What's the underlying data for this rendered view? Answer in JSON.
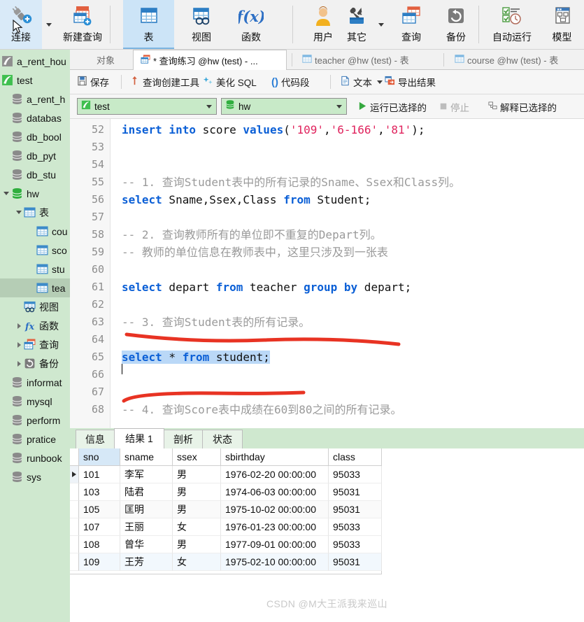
{
  "toolbar": {
    "items": [
      {
        "label": "连接",
        "icon": "connect-plug-icon",
        "caret": true,
        "selected": false
      },
      {
        "label": "新建查询",
        "icon": "new-query-icon",
        "caret": false,
        "selected": false
      },
      {
        "label": "表",
        "icon": "table-icon",
        "caret": false,
        "selected": true
      },
      {
        "label": "视图",
        "icon": "view-icon",
        "caret": false,
        "selected": false
      },
      {
        "label": "函数",
        "icon": "function-fx-icon",
        "caret": false,
        "selected": false
      },
      {
        "label": "用户",
        "icon": "user-icon",
        "caret": false,
        "selected": false
      },
      {
        "label": "其它",
        "icon": "other-tools-icon",
        "caret": true,
        "selected": false
      },
      {
        "label": "查询",
        "icon": "query-icon",
        "caret": false,
        "selected": false
      },
      {
        "label": "备份",
        "icon": "backup-icon",
        "caret": false,
        "selected": false
      },
      {
        "label": "自动运行",
        "icon": "automation-icon",
        "caret": false,
        "selected": false
      },
      {
        "label": "模型",
        "icon": "model-icon",
        "caret": false,
        "selected": false
      }
    ]
  },
  "tabs": [
    {
      "label": "对象",
      "icon": "",
      "active": false
    },
    {
      "label": "* 查询练习 @hw (test) - ...",
      "icon": "query-tab-icon",
      "active": true
    },
    {
      "label": "teacher @hw (test) - 表",
      "icon": "table-tab-icon",
      "active": false
    },
    {
      "label": "course @hw (test) - 表",
      "icon": "table-tab-icon",
      "active": false
    }
  ],
  "actionbar": {
    "items": [
      {
        "label": "保存",
        "icon": "save-icon"
      },
      {
        "label": "查询创建工具",
        "icon": "query-builder-icon"
      },
      {
        "label": "美化 SQL",
        "icon": "beautify-sql-icon"
      },
      {
        "label": "代码段",
        "icon": "code-snippet-icon"
      },
      {
        "label": "文本",
        "icon": "text-icon",
        "caret": true
      },
      {
        "label": "导出结果",
        "icon": "export-result-icon"
      }
    ]
  },
  "connbar": {
    "connection": {
      "value": "test",
      "icon": "connection-icon"
    },
    "database": {
      "value": "hw",
      "icon": "database-icon"
    },
    "run_selected": "运行已选择的",
    "stop": "停止",
    "explain_selected": "解释已选择的"
  },
  "sidebar": {
    "items": [
      {
        "label": "a_rent_hou",
        "indent": 0,
        "icon": "connection-icon",
        "twisty": "",
        "selected": false
      },
      {
        "label": "test",
        "indent": 0,
        "icon": "connection-icon-green",
        "twisty": "",
        "selected": false
      },
      {
        "label": "a_rent_h",
        "indent": 1,
        "icon": "database-icon",
        "twisty": "",
        "selected": false
      },
      {
        "label": "databas",
        "indent": 1,
        "icon": "database-icon",
        "twisty": "",
        "selected": false
      },
      {
        "label": "db_bool",
        "indent": 1,
        "icon": "database-icon",
        "twisty": "",
        "selected": false
      },
      {
        "label": "db_pyt",
        "indent": 1,
        "icon": "database-icon",
        "twisty": "",
        "selected": false
      },
      {
        "label": "db_stu",
        "indent": 1,
        "icon": "database-icon",
        "twisty": "",
        "selected": false
      },
      {
        "label": "hw",
        "indent": 1,
        "icon": "database-icon-green",
        "twisty": "down",
        "selected": false
      },
      {
        "label": "表",
        "indent": 2,
        "icon": "table-folder-icon",
        "twisty": "down",
        "selected": false
      },
      {
        "label": "cou",
        "indent": 3,
        "icon": "table-icon",
        "twisty": "",
        "selected": false
      },
      {
        "label": "sco",
        "indent": 3,
        "icon": "table-icon",
        "twisty": "",
        "selected": false
      },
      {
        "label": "stu",
        "indent": 3,
        "icon": "table-icon",
        "twisty": "",
        "selected": false
      },
      {
        "label": "tea",
        "indent": 3,
        "icon": "table-icon",
        "twisty": "",
        "selected": true
      },
      {
        "label": "视图",
        "indent": 2,
        "icon": "view-icon",
        "twisty": "",
        "selected": false
      },
      {
        "label": "函数",
        "indent": 2,
        "icon": "function-fx-icon",
        "twisty": "right",
        "selected": false
      },
      {
        "label": "查询",
        "indent": 2,
        "icon": "query-icon",
        "twisty": "right",
        "selected": false
      },
      {
        "label": "备份",
        "indent": 2,
        "icon": "backup-icon",
        "twisty": "right",
        "selected": false
      },
      {
        "label": "informat",
        "indent": 1,
        "icon": "database-icon",
        "twisty": "",
        "selected": false
      },
      {
        "label": "mysql",
        "indent": 1,
        "icon": "database-icon",
        "twisty": "",
        "selected": false
      },
      {
        "label": "perform",
        "indent": 1,
        "icon": "database-icon",
        "twisty": "",
        "selected": false
      },
      {
        "label": "pratice",
        "indent": 1,
        "icon": "database-icon",
        "twisty": "",
        "selected": false
      },
      {
        "label": "runbook",
        "indent": 1,
        "icon": "database-icon",
        "twisty": "",
        "selected": false
      },
      {
        "label": "sys",
        "indent": 1,
        "icon": "database-icon",
        "twisty": "",
        "selected": false
      }
    ]
  },
  "editor": {
    "lines": [
      {
        "n": "52",
        "segments": [
          {
            "t": "insert into",
            "c": "kw"
          },
          {
            "t": " score ",
            "c": ""
          },
          {
            "t": "values",
            "c": "kw"
          },
          {
            "t": "(",
            "c": ""
          },
          {
            "t": "'109'",
            "c": "str"
          },
          {
            "t": ",",
            "c": ""
          },
          {
            "t": "'6-166'",
            "c": "str"
          },
          {
            "t": ",",
            "c": ""
          },
          {
            "t": "'81'",
            "c": "str"
          },
          {
            "t": ");",
            "c": ""
          }
        ]
      },
      {
        "n": "53",
        "segments": []
      },
      {
        "n": "54",
        "segments": []
      },
      {
        "n": "55",
        "segments": [
          {
            "t": "-- 1. 查询Student表中的所有记录的Sname、Ssex和Class列。",
            "c": "cmt"
          }
        ]
      },
      {
        "n": "56",
        "segments": [
          {
            "t": "select",
            "c": "kw"
          },
          {
            "t": " Sname,Ssex,Class ",
            "c": ""
          },
          {
            "t": "from",
            "c": "kw"
          },
          {
            "t": " Student;",
            "c": ""
          }
        ]
      },
      {
        "n": "57",
        "segments": []
      },
      {
        "n": "58",
        "segments": [
          {
            "t": "-- 2. 查询教师所有的单位即不重复的Depart列。",
            "c": "cmt"
          }
        ]
      },
      {
        "n": "59",
        "segments": [
          {
            "t": "-- 教师的单位信息在教师表中，这里只涉及到一张表",
            "c": "cmt"
          }
        ]
      },
      {
        "n": "60",
        "segments": []
      },
      {
        "n": "61",
        "segments": [
          {
            "t": "select",
            "c": "kw"
          },
          {
            "t": " depart ",
            "c": ""
          },
          {
            "t": "from",
            "c": "kw"
          },
          {
            "t": " teacher ",
            "c": ""
          },
          {
            "t": "group",
            "c": "kw"
          },
          {
            "t": " ",
            "c": ""
          },
          {
            "t": "by",
            "c": "kw"
          },
          {
            "t": " depart;",
            "c": ""
          }
        ]
      },
      {
        "n": "62",
        "segments": []
      },
      {
        "n": "63",
        "segments": [
          {
            "t": "-- 3. 查询Student表的所有记录。",
            "c": "cmt"
          }
        ]
      },
      {
        "n": "64",
        "segments": []
      },
      {
        "n": "65",
        "segments": [
          {
            "t": "select",
            "c": "kw sel-code"
          },
          {
            "t": " * ",
            "c": "sel-code"
          },
          {
            "t": "from",
            "c": "kw sel-code"
          },
          {
            "t": " student;",
            "c": "sel-code"
          }
        ]
      },
      {
        "n": "66",
        "segments": []
      },
      {
        "n": "67",
        "segments": []
      },
      {
        "n": "68",
        "segments": [
          {
            "t": "-- 4. 查询Score表中成绩在60到80之间的所有记录。",
            "c": "cmt"
          }
        ]
      }
    ]
  },
  "results": {
    "tabs": [
      {
        "label": "信息",
        "active": false
      },
      {
        "label": "结果 1",
        "active": true
      },
      {
        "label": "剖析",
        "active": false
      },
      {
        "label": "状态",
        "active": false
      }
    ],
    "columns": [
      "sno",
      "sname",
      "ssex",
      "sbirthday",
      "class"
    ],
    "rows": [
      [
        "101",
        "李军",
        "男",
        "1976-02-20 00:00:00",
        "95033"
      ],
      [
        "103",
        "陆君",
        "男",
        "1974-06-03 00:00:00",
        "95031"
      ],
      [
        "105",
        "匡明",
        "男",
        "1975-10-02 00:00:00",
        "95031"
      ],
      [
        "107",
        "王丽",
        "女",
        "1976-01-23 00:00:00",
        "95033"
      ],
      [
        "108",
        "曾华",
        "男",
        "1977-09-01 00:00:00",
        "95033"
      ],
      [
        "109",
        "王芳",
        "女",
        "1975-02-10 00:00:00",
        "95031"
      ]
    ],
    "current_row_index": 0
  },
  "watermark": "CSDN @M大王派我来巡山",
  "colors": {
    "toolbar_bg": "#f1f1f1",
    "selected_tool": "#cce4f7",
    "sidebar_bg": "#cfe8cf",
    "sidebar_selected": "#b5cdb5",
    "combo_bg": "#c8eac8",
    "keyword": "#0b5fd6",
    "string": "#e0245e",
    "comment": "#9a9a9a",
    "selection": "#bad8f7",
    "annotation": "#e83323",
    "key_column": "#d6e8f7"
  }
}
